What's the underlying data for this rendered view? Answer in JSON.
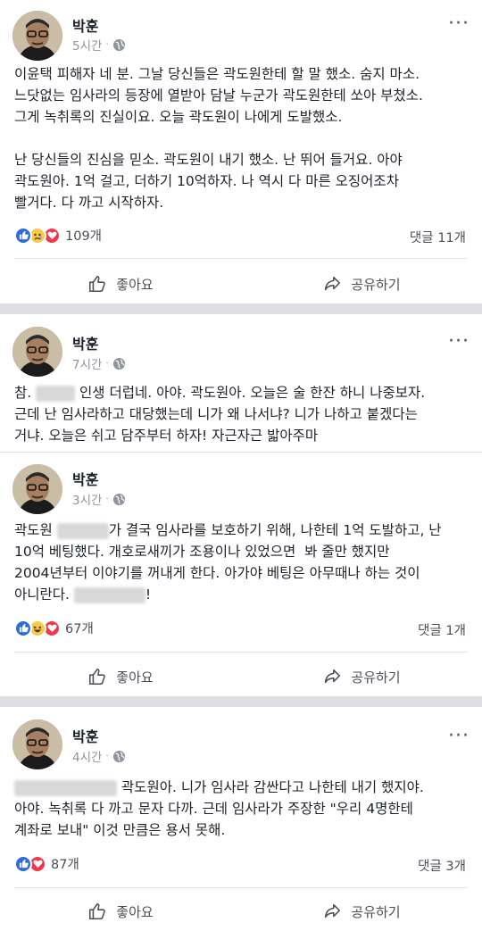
{
  "posts": [
    {
      "author": "박훈",
      "time": "5시간",
      "dot": "·",
      "more": "···",
      "text": "이윤택 피해자 네 분. 그날 당신들은 곽도원한테 할 말 했소. 숨지 마소.\n느닷없는 임사라의 등장에 열받아 담날 누군가 곽도원한테 쏘아 부쳤소.\n그게 녹취록의 진실이요. 오늘 곽도원이 나에게 도발했소.\n\n난 당신들의 진심을 믿소. 곽도원이 내기 했소. 난 뛰어 들거요. 아야\n곽도원아. 1억 걸고, 더하기 10억하자. 나 역시 다 마른 오징어조차\n빨거다. 다 까고 시작하자.",
      "reaction_count": "109개",
      "comment_count": "댓글 11개",
      "like_label": "좋아요",
      "share_label": "공유하기"
    },
    {
      "author": "박훈",
      "time": "7시간",
      "dot": "·",
      "more": "···",
      "text_a": "참. ",
      "text_b": " 인생 더럽네. 아야. 곽도원아. 오늘은 술 한잔 하니 나중보자.\n근데 난 임사라하고 대당했는데 니가 왜 나서냐? 니가 나하고 붙겠다는\n거냐. 오늘은 쉬고 담주부터 하자! 자근자근 밟아주마"
    },
    {
      "author": "박훈",
      "time": "3시간",
      "dot": "·",
      "text_a": "곽도원 ",
      "text_b": "가 결국 임사라를 보호하기 위해, 나한테 1억 도발하고, 난\n10억 베팅했다. 개호로새끼가 조용이나 있었으면  봐 줄만 했지만\n2004년부터 이야기를 꺼내게 한다. 아가야 베팅은 아무때나 하는 것이\n아니란다. ",
      "text_c": "!",
      "reaction_count": "67개",
      "comment_count": "댓글 1개",
      "like_label": "좋아요",
      "share_label": "공유하기"
    },
    {
      "author": "박훈",
      "time": "4시간",
      "dot": "·",
      "more": "···",
      "text_b": " 곽도원아. 니가 임사라 감싼다고 나한테 내기 했지야.\n아야. 녹취록 다 까고 문자 다까. 근데 임사라가 주장한 \"우리 4명한테\n계좌로 보내\" 이것 만큼은 용서 못해.",
      "reaction_count": "87개",
      "comment_count": "댓글 3개",
      "like_label": "좋아요",
      "share_label": "공유하기"
    }
  ],
  "colors": {
    "like_blue": "#2f6bd8",
    "love_red": "#f0384a",
    "haha_yellow": "#f7c94a",
    "separator": "#dddfe2"
  },
  "icons": [
    "globe-icon",
    "like-reaction-icon",
    "sad-reaction-icon",
    "love-reaction-icon",
    "haha-reaction-icon",
    "thumbs-up-icon",
    "share-arrow-icon",
    "more-icon"
  ]
}
